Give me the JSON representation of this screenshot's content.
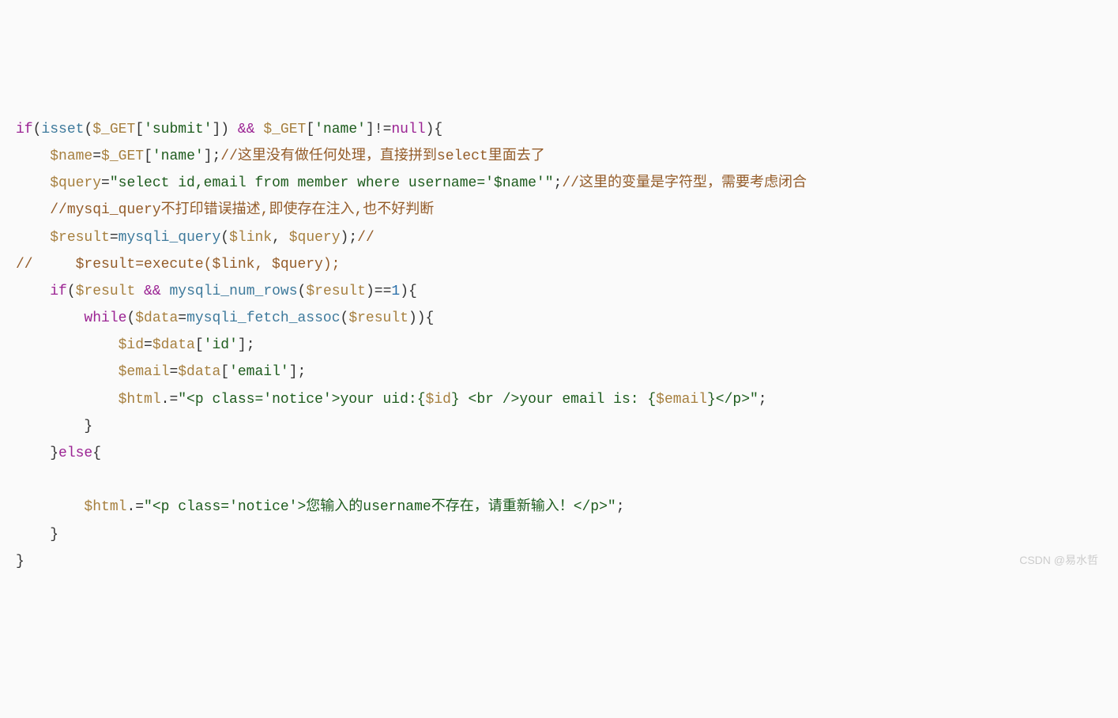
{
  "code": {
    "lines": [
      {
        "indent": 0,
        "tokens": [
          {
            "t": "if",
            "c": "kw"
          },
          {
            "t": "(",
            "c": "op"
          },
          {
            "t": "isset",
            "c": "func"
          },
          {
            "t": "(",
            "c": "op"
          },
          {
            "t": "$_GET",
            "c": "var"
          },
          {
            "t": "[",
            "c": "op"
          },
          {
            "t": "'submit'",
            "c": "str"
          },
          {
            "t": "]) ",
            "c": "op"
          },
          {
            "t": "&&",
            "c": "kw"
          },
          {
            "t": " ",
            "c": "op"
          },
          {
            "t": "$_GET",
            "c": "var"
          },
          {
            "t": "[",
            "c": "op"
          },
          {
            "t": "'name'",
            "c": "str"
          },
          {
            "t": "]!=",
            "c": "op"
          },
          {
            "t": "null",
            "c": "null"
          },
          {
            "t": "){",
            "c": "op"
          }
        ]
      },
      {
        "indent": 4,
        "tokens": [
          {
            "t": "$name",
            "c": "var"
          },
          {
            "t": "=",
            "c": "op"
          },
          {
            "t": "$_GET",
            "c": "var"
          },
          {
            "t": "[",
            "c": "op"
          },
          {
            "t": "'name'",
            "c": "str"
          },
          {
            "t": "];",
            "c": "op"
          },
          {
            "t": "//这里没有做任何处理，直接拼到select里面去了",
            "c": "comment"
          }
        ]
      },
      {
        "indent": 4,
        "tokens": [
          {
            "t": "$query",
            "c": "var"
          },
          {
            "t": "=",
            "c": "op"
          },
          {
            "t": "\"select id,email from member where username='$name'\"",
            "c": "str"
          },
          {
            "t": ";",
            "c": "op"
          },
          {
            "t": "//这里的变量是字符型，需要考虑闭合",
            "c": "comment"
          }
        ]
      },
      {
        "indent": 4,
        "tokens": [
          {
            "t": "//mysqi_query不打印错误描述,即使存在注入,也不好判断",
            "c": "comment"
          }
        ]
      },
      {
        "indent": 4,
        "tokens": [
          {
            "t": "$result",
            "c": "var"
          },
          {
            "t": "=",
            "c": "op"
          },
          {
            "t": "mysqli_query",
            "c": "func"
          },
          {
            "t": "(",
            "c": "op"
          },
          {
            "t": "$link",
            "c": "var"
          },
          {
            "t": ", ",
            "c": "op"
          },
          {
            "t": "$query",
            "c": "var"
          },
          {
            "t": ");",
            "c": "op"
          },
          {
            "t": "//",
            "c": "comment"
          }
        ]
      },
      {
        "indent": 0,
        "tokens": [
          {
            "t": "//     $result=execute($link, $query);",
            "c": "comment"
          }
        ]
      },
      {
        "indent": 4,
        "tokens": [
          {
            "t": "if",
            "c": "kw"
          },
          {
            "t": "(",
            "c": "op"
          },
          {
            "t": "$result",
            "c": "var"
          },
          {
            "t": " ",
            "c": "op"
          },
          {
            "t": "&&",
            "c": "kw"
          },
          {
            "t": " ",
            "c": "op"
          },
          {
            "t": "mysqli_num_rows",
            "c": "func"
          },
          {
            "t": "(",
            "c": "op"
          },
          {
            "t": "$result",
            "c": "var"
          },
          {
            "t": ")==",
            "c": "op"
          },
          {
            "t": "1",
            "c": "num"
          },
          {
            "t": "){",
            "c": "op"
          }
        ]
      },
      {
        "indent": 8,
        "tokens": [
          {
            "t": "while",
            "c": "kw"
          },
          {
            "t": "(",
            "c": "op"
          },
          {
            "t": "$data",
            "c": "var"
          },
          {
            "t": "=",
            "c": "op"
          },
          {
            "t": "mysqli_fetch_assoc",
            "c": "func"
          },
          {
            "t": "(",
            "c": "op"
          },
          {
            "t": "$result",
            "c": "var"
          },
          {
            "t": ")){",
            "c": "op"
          }
        ]
      },
      {
        "indent": 12,
        "tokens": [
          {
            "t": "$id",
            "c": "var"
          },
          {
            "t": "=",
            "c": "op"
          },
          {
            "t": "$data",
            "c": "var"
          },
          {
            "t": "[",
            "c": "op"
          },
          {
            "t": "'id'",
            "c": "str"
          },
          {
            "t": "];",
            "c": "op"
          }
        ]
      },
      {
        "indent": 12,
        "tokens": [
          {
            "t": "$email",
            "c": "var"
          },
          {
            "t": "=",
            "c": "op"
          },
          {
            "t": "$data",
            "c": "var"
          },
          {
            "t": "[",
            "c": "op"
          },
          {
            "t": "'email'",
            "c": "str"
          },
          {
            "t": "];",
            "c": "op"
          }
        ]
      },
      {
        "indent": 12,
        "tokens": [
          {
            "t": "$html",
            "c": "var"
          },
          {
            "t": ".=",
            "c": "op"
          },
          {
            "t": "\"<p class='notice'>your uid:{",
            "c": "str"
          },
          {
            "t": "$id",
            "c": "var"
          },
          {
            "t": "} <br />your email is: {",
            "c": "str"
          },
          {
            "t": "$email",
            "c": "var"
          },
          {
            "t": "}</p>\"",
            "c": "str"
          },
          {
            "t": ";",
            "c": "op"
          }
        ]
      },
      {
        "indent": 8,
        "tokens": [
          {
            "t": "}",
            "c": "op"
          }
        ]
      },
      {
        "indent": 4,
        "tokens": [
          {
            "t": "}",
            "c": "op"
          },
          {
            "t": "else",
            "c": "kw"
          },
          {
            "t": "{",
            "c": "op"
          }
        ]
      },
      {
        "indent": 0,
        "tokens": []
      },
      {
        "indent": 8,
        "tokens": [
          {
            "t": "$html",
            "c": "var"
          },
          {
            "t": ".=",
            "c": "op"
          },
          {
            "t": "\"<p class='notice'>您输入的username不存在，请重新输入！</p>\"",
            "c": "str"
          },
          {
            "t": ";",
            "c": "op"
          }
        ]
      },
      {
        "indent": 4,
        "tokens": [
          {
            "t": "}",
            "c": "op"
          }
        ]
      },
      {
        "indent": 0,
        "tokens": [
          {
            "t": "}",
            "c": "op"
          }
        ]
      }
    ]
  },
  "watermark": "CSDN @易水哲"
}
